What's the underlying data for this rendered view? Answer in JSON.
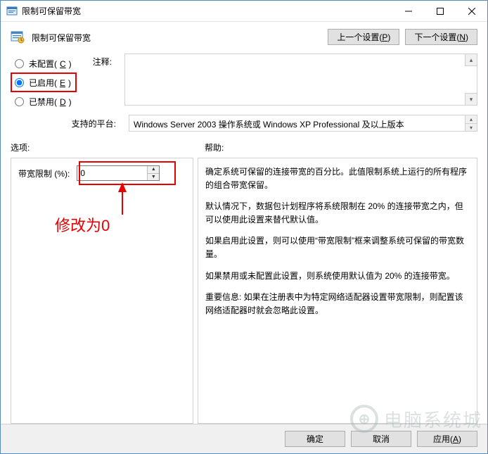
{
  "window": {
    "title": "限制可保留带宽"
  },
  "header": {
    "section_title": "限制可保留带宽",
    "prev_button": "上一个设置(P)",
    "next_button": "下一个设置(N)"
  },
  "radios": {
    "not_configured": "未配置(C)",
    "enabled": "已启用(E)",
    "disabled": "已禁用(D)",
    "selected": "enabled"
  },
  "labels": {
    "comment": "注释:",
    "platform": "支持的平台:",
    "options": "选项:",
    "help": "帮助:"
  },
  "platform_text": "Windows Server 2003 操作系统或 Windows XP Professional 及以上版本",
  "options_panel": {
    "bandwidth_label": "带宽限制 (%):",
    "bandwidth_value": "0"
  },
  "help_panel": {
    "p1": "确定系统可保留的连接带宽的百分比。此值限制系统上运行的所有程序的组合带宽保留。",
    "p2": "默认情况下，数据包计划程序将系统限制在 20% 的连接带宽之内，但可以使用此设置来替代默认值。",
    "p3": "如果启用此设置，则可以使用“带宽限制”框来调整系统可保留的带宽数量。",
    "p4": "如果禁用或未配置此设置，则系统使用默认值为 20% 的连接带宽。",
    "p5": "重要信息: 如果在注册表中为特定网络适配器设置带宽限制，则配置该网络适配器时就会忽略此设置。"
  },
  "footer": {
    "ok": "确定",
    "cancel": "取消",
    "apply": "应用(A)"
  },
  "annotation": {
    "text": "修改为0"
  },
  "watermark": {
    "text": "电脑系统城"
  }
}
